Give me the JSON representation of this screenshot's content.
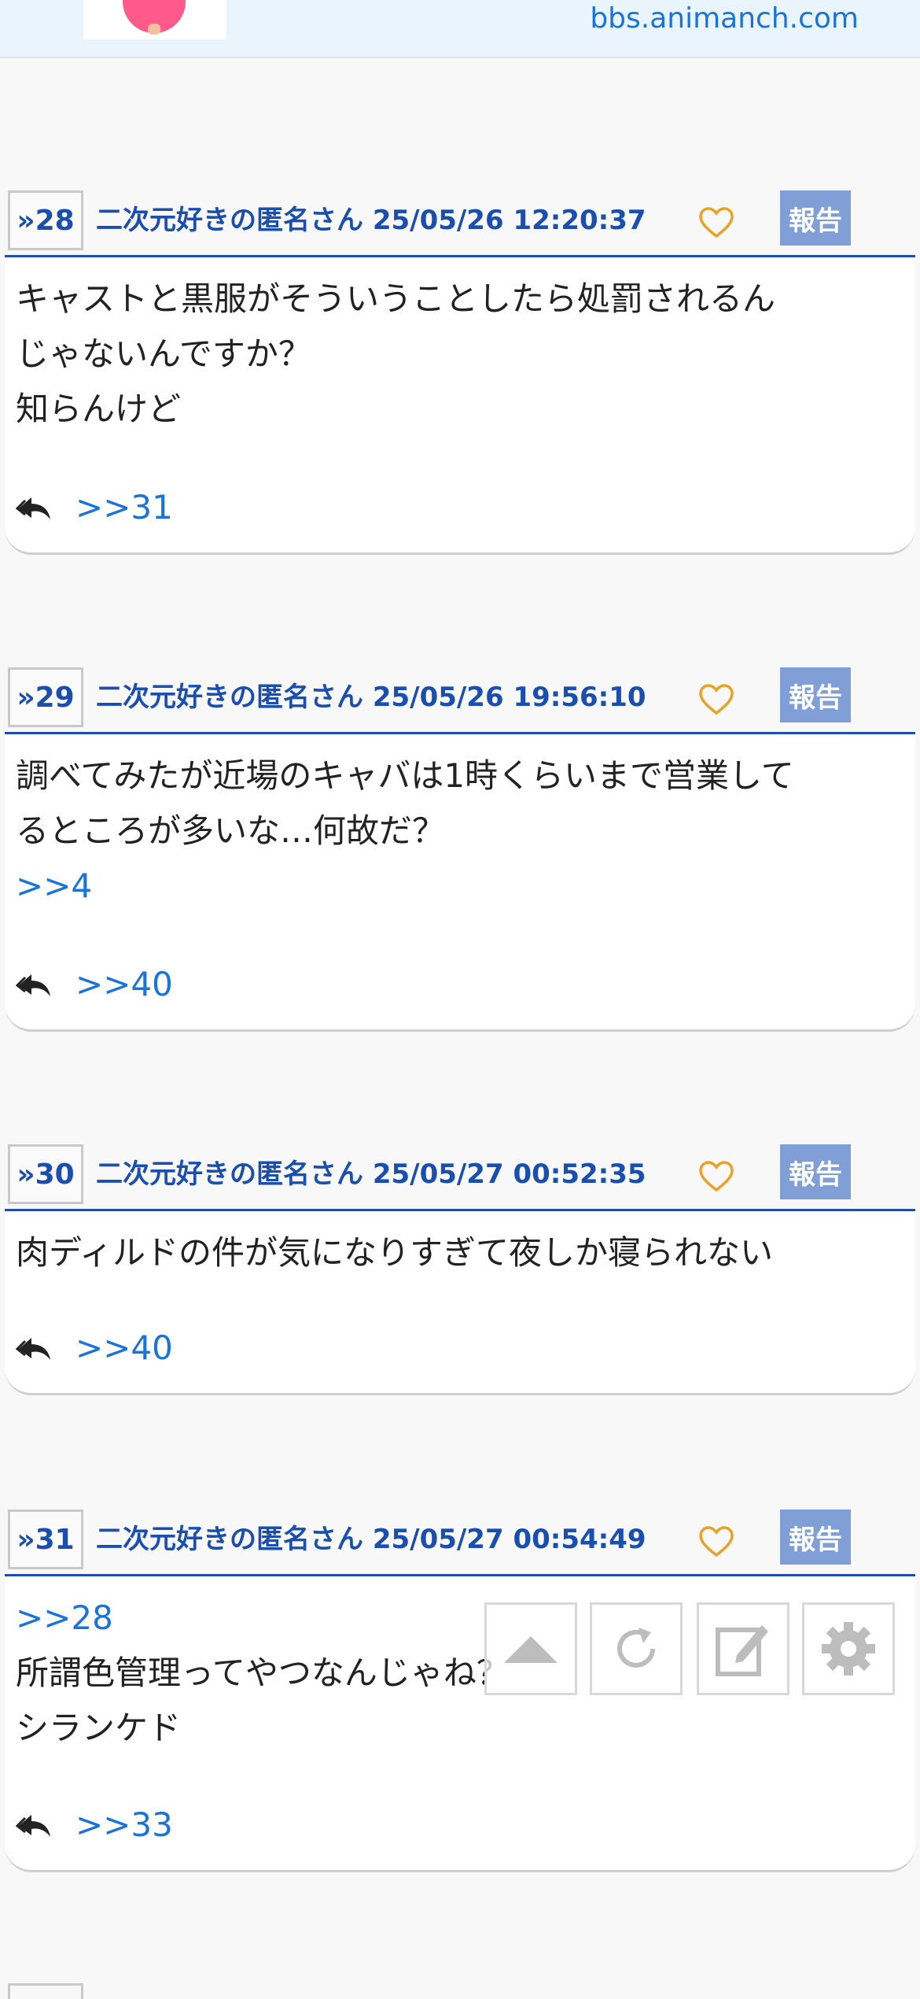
{
  "header": {
    "domain": "bbs.animanch.com"
  },
  "posts": [
    {
      "number": "»28",
      "meta": "二次元好きの匿名さん 25/05/26 12:20:37",
      "report_label": "報告",
      "lines": [
        "キャストと黒服がそういうことしたら処罰されるん",
        "じゃないんですか？",
        "知らんけど"
      ],
      "anchors": [],
      "reply": ">>31"
    },
    {
      "number": "»29",
      "meta": "二次元好きの匿名さん 25/05/26 19:56:10",
      "report_label": "報告",
      "lines": [
        "調べてみたが近場のキャバは1時くらいまで営業して",
        "るところが多いな…何故だ？"
      ],
      "anchors": [
        ">>4"
      ],
      "reply": ">>40"
    },
    {
      "number": "»30",
      "meta": "二次元好きの匿名さん 25/05/27 00:52:35",
      "report_label": "報告",
      "lines": [
        "肉ディルドの件が気になりすぎて夜しか寝られない"
      ],
      "anchors": [],
      "reply": ">>40"
    },
    {
      "number": "»31",
      "meta": "二次元好きの匿名さん 25/05/27 00:54:49",
      "report_label": "報告",
      "anchor_first": ">>28",
      "lines": [
        "所謂色管理ってやつなんじゃね？",
        "シランケド"
      ],
      "anchors": [],
      "reply": ">>33"
    }
  ],
  "floating_buttons": [
    {
      "name": "scroll-top",
      "icon": "up-arrow-icon"
    },
    {
      "name": "reload",
      "icon": "reload-icon"
    },
    {
      "name": "write",
      "icon": "edit-icon"
    },
    {
      "name": "settings",
      "icon": "gear-icon"
    }
  ],
  "colors": {
    "link": "#1a73d9",
    "header_text": "#1a4fb0",
    "report_bg": "#7f9fd6",
    "heart": "#e9a128"
  }
}
